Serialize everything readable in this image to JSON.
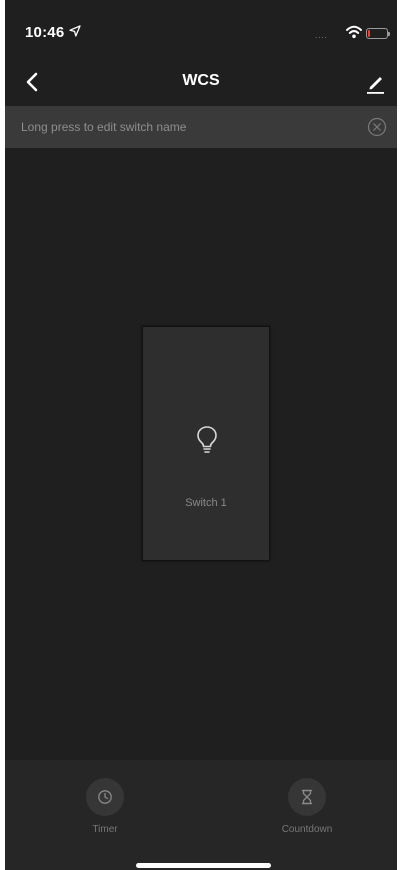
{
  "status_bar": {
    "time": "10:46",
    "signal": "....",
    "battery_level": 0.12
  },
  "nav": {
    "title": "WCS",
    "back_icon": "chevron-left-icon",
    "edit_icon": "pencil-icon"
  },
  "hint": {
    "text": "Long press to edit switch name",
    "close_icon": "close-circle-icon"
  },
  "switch": {
    "label": "Switch 1",
    "icon": "lightbulb-icon"
  },
  "toolbar": {
    "timer_label": "Timer",
    "timer_icon": "clock-icon",
    "countdown_label": "Countdown",
    "countdown_icon": "hourglass-icon"
  },
  "colors": {
    "background": "#1f1f1f",
    "banner": "#3a3a3a",
    "panel": "#2e2e2e",
    "battery_low": "#ff3b30"
  }
}
